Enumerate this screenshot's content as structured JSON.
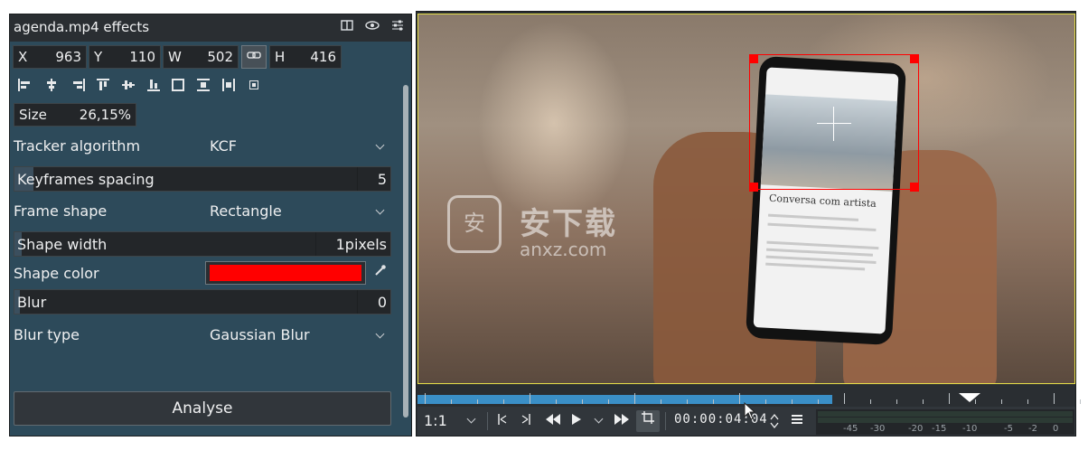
{
  "panel": {
    "title": "agenda.mp4 effects",
    "header_icons": [
      "split-view-icon",
      "eye-icon",
      "settings-sliders-icon"
    ]
  },
  "geometry": {
    "x_label": "X",
    "x_value": "963",
    "y_label": "Y",
    "y_value": "110",
    "w_label": "W",
    "w_value": "502",
    "h_label": "H",
    "h_value": "416",
    "lock_icon": "link-icon"
  },
  "align_icons": [
    "align-left-icon",
    "align-hcenter-icon",
    "align-right-icon",
    "align-top-icon",
    "align-vcenter-icon",
    "align-bottom-icon",
    "fit-frame-icon",
    "fit-width-icon",
    "fit-height-icon",
    "reset-size-icon"
  ],
  "size": {
    "label": "Size",
    "value": "26,15%"
  },
  "tracker": {
    "label": "Tracker algorithm",
    "value": "KCF"
  },
  "keyframes": {
    "label": "Keyframes spacing",
    "value": "5",
    "fraction": 0.05
  },
  "frame_shape": {
    "label": "Frame shape",
    "value": "Rectangle"
  },
  "shape_width": {
    "label": "Shape width",
    "value": "1pixels",
    "fraction": 0.02
  },
  "shape_color": {
    "label": "Shape color",
    "color": "#ff0000",
    "picker_icon": "eyedropper-icon"
  },
  "blur": {
    "label": "Blur",
    "value": "0",
    "fraction": 0.0
  },
  "blur_type": {
    "label": "Blur type",
    "value": "Gaussian Blur"
  },
  "analyse_button": "Analyse",
  "video": {
    "phone_heading": "Conversa com artista",
    "watermark_text": "安下载",
    "watermark_sub": "anxz.com",
    "watermark_badge": "安"
  },
  "transport": {
    "zoom": "1:1",
    "timecode": "00:00:04:04",
    "buttons": [
      "in-point-icon",
      "out-point-icon",
      "rewind-icon",
      "play-icon",
      "play-menu-icon",
      "forward-icon",
      "crop-icon",
      "spinner-icon",
      "menu-icon"
    ]
  },
  "audio_scale": [
    "-45",
    "-30",
    "-20",
    "-15",
    "-10",
    "-5",
    "-2",
    "0"
  ],
  "colors": {
    "accent": "#3a8fc7",
    "track": "#ff0000",
    "frame_border": "#e7e04a",
    "panel_bg": "#2d4a5a"
  }
}
